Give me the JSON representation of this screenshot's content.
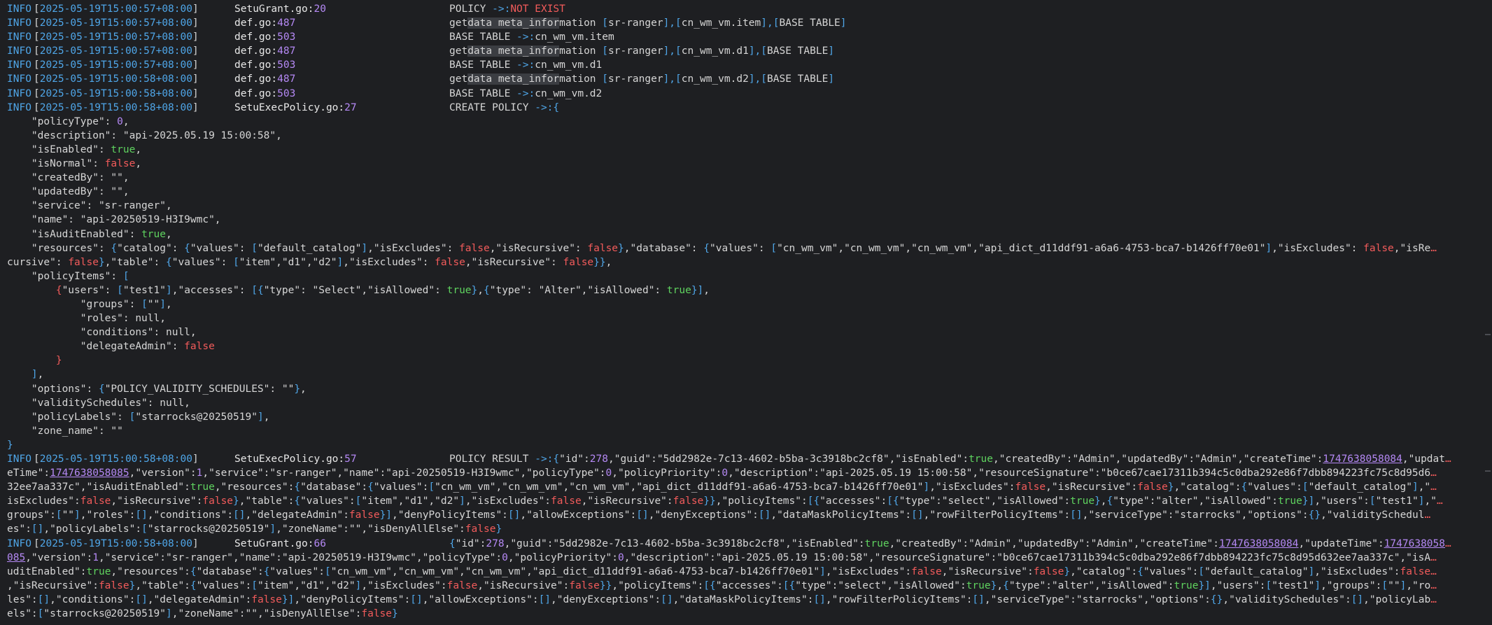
{
  "log": [
    {
      "level": "INFO",
      "ts": "2025-05-19T15:00:57+08:00",
      "file": "SetuGrant.go",
      "line": "20",
      "msg_html": "POLICY <span class=\"blue\">-&gt;:</span><span class=\"red\">NOT EXIST</span>"
    },
    {
      "level": "INFO",
      "ts": "2025-05-19T15:00:57+08:00",
      "file": "def.go",
      "line": "487",
      "msg_html": "get<span class=\"hl\">data meta_infor</span>mation <span class=\"blue\">[</span>sr-ranger<span class=\"blue\">],[</span>cn_wm_vm.item<span class=\"blue\">],[</span>BASE TABLE<span class=\"blue\">]</span>"
    },
    {
      "level": "INFO",
      "ts": "2025-05-19T15:00:57+08:00",
      "file": "def.go",
      "line": "503",
      "msg_html": "BASE TABLE <span class=\"blue\">-&gt;:</span>cn_wm_vm.item"
    },
    {
      "level": "INFO",
      "ts": "2025-05-19T15:00:57+08:00",
      "file": "def.go",
      "line": "487",
      "msg_html": "get<span class=\"hl\">data meta_infor</span>mation <span class=\"blue\">[</span>sr-ranger<span class=\"blue\">],[</span>cn_wm_vm.d1<span class=\"blue\">],[</span>BASE TABLE<span class=\"blue\">]</span>"
    },
    {
      "level": "INFO",
      "ts": "2025-05-19T15:00:57+08:00",
      "file": "def.go",
      "line": "503",
      "msg_html": "BASE TABLE <span class=\"blue\">-&gt;:</span>cn_wm_vm.d1"
    },
    {
      "level": "INFO",
      "ts": "2025-05-19T15:00:58+08:00",
      "file": "def.go",
      "line": "487",
      "msg_html": "get<span class=\"hl\">data meta_infor</span>mation <span class=\"blue\">[</span>sr-ranger<span class=\"blue\">],[</span>cn_wm_vm.d2<span class=\"blue\">],[</span>BASE TABLE<span class=\"blue\">]</span>"
    },
    {
      "level": "INFO",
      "ts": "2025-05-19T15:00:58+08:00",
      "file": "def.go",
      "line": "503",
      "msg_html": "BASE TABLE <span class=\"blue\">-&gt;:</span>cn_wm_vm.d2"
    },
    {
      "level": "INFO",
      "ts": "2025-05-19T15:00:58+08:00",
      "file": "SetuExecPolicy.go",
      "line": "27",
      "msg_html": "CREATE POLICY <span class=\"blue\">-&gt;:{</span>"
    },
    {
      "html": "    \"policyType\": <span class=\"purple\">0</span>,"
    },
    {
      "html": "    \"description\": \"api-2025.05.19 15:00:58\","
    },
    {
      "html": "    \"isEnabled\": <span class=\"green\">true</span>,"
    },
    {
      "html": "    \"isNormal\": <span class=\"red\">false</span>,"
    },
    {
      "html": "    \"createdBy\": \"\","
    },
    {
      "html": "    \"updatedBy\": \"\","
    },
    {
      "html": "    \"service\": \"sr-ranger\","
    },
    {
      "html": "    \"name\": \"api-20250519-H3I9wmc\","
    },
    {
      "html": "    \"isAuditEnabled\": <span class=\"green\">true</span>,"
    },
    {
      "html": "    \"resources\": <span class=\"blue\">{</span>\"catalog\": <span class=\"blue\">{</span>\"values\": <span class=\"blue\">[</span>\"default_catalog\"<span class=\"blue\">]</span>,\"isExcludes\": <span class=\"red\">false</span>,\"isRecursive\": <span class=\"red\">false</span><span class=\"blue\">}</span>,\"database\": <span class=\"blue\">{</span>\"values\": <span class=\"blue\">[</span>\"cn_wm_vm\",\"cn_wm_vm\",\"cn_wm_vm\",\"api_dict_d11ddf91-a6a6-4753-bca7-b1426ff70e01\"<span class=\"blue\">]</span>,\"isExcludes\": <span class=\"red\">false</span>,\"isRe<span class=\"cut\">…</span>"
    },
    {
      "html": "cursive\": <span class=\"red\">false</span><span class=\"blue\">}</span>,\"table\": <span class=\"blue\">{</span>\"values\": <span class=\"blue\">[</span>\"item\",\"d1\",\"d2\"<span class=\"blue\">]</span>,\"isExcludes\": <span class=\"red\">false</span>,\"isRecursive\": <span class=\"red\">false</span><span class=\"blue\">}}</span>,"
    },
    {
      "html": "    \"policyItems\": <span class=\"blue\">[</span>"
    },
    {
      "html": "        <span class=\"red\">{</span>\"users\": <span class=\"blue\">[</span>\"test1\"<span class=\"blue\">]</span>,\"accesses\": <span class=\"blue\">[{</span>\"type\": \"Select\",\"isAllowed\": <span class=\"green\">true</span><span class=\"blue\">}</span>,<span class=\"blue\">{</span>\"type\": \"Alter\",\"isAllowed\": <span class=\"green\">true</span><span class=\"blue\">}]</span>,"
    },
    {
      "html": "            \"groups\": <span class=\"blue\">[</span>\"\"<span class=\"blue\">]</span>,"
    },
    {
      "html": "            \"roles\": null,"
    },
    {
      "html": "            \"conditions\": null,"
    },
    {
      "html": "            \"delegateAdmin\": <span class=\"red\">false</span>"
    },
    {
      "html": "        <span class=\"red\">}</span>"
    },
    {
      "html": "    <span class=\"blue\">]</span>,"
    },
    {
      "html": "    \"options\": <span class=\"blue\">{</span>\"POLICY_VALIDITY_SCHEDULES\": \"\"<span class=\"blue\">}</span>,"
    },
    {
      "html": "    \"validitySchedules\": null,"
    },
    {
      "html": "    \"policyLabels\": <span class=\"blue\">[</span>\"starrocks@20250519\"<span class=\"blue\">]</span>,"
    },
    {
      "html": "    \"zone_name\": \"\""
    },
    {
      "html": "<span class=\"blue\">}</span>"
    },
    {
      "level": "INFO",
      "ts": "2025-05-19T15:00:58+08:00",
      "file": "SetuExecPolicy.go",
      "line": "57",
      "msg_html": "POLICY RESULT <span class=\"blue\">-&gt;:{</span>\"id\":<span class=\"purple\">278</span>,\"guid\":\"5dd2982e-7c13-4602-b5ba-3c3918bc2cf8\",\"isEnabled\":<span class=\"green\">true</span>,\"createdBy\":\"Admin\",\"updatedBy\":\"Admin\",\"createTime\":<span class=\"link\">1747638058084</span>,\"updat<span class=\"cut\">…</span>"
    },
    {
      "html": "eTime\":<span class=\"link\">1747638058085</span>,\"version\":<span class=\"purple\">1</span>,\"service\":\"sr-ranger\",\"name\":\"api-20250519-H3I9wmc\",\"policyType\":<span class=\"purple\">0</span>,\"policyPriority\":<span class=\"purple\">0</span>,\"description\":\"api-2025.05.19 15:00:58\",\"resourceSignature\":\"b0ce67cae17311b394c5c0dba292e86f7dbb894223fc75c8d95d6<span class=\"cut\">…</span>"
    },
    {
      "html": "32ee7aa337c\",\"isAuditEnabled\":<span class=\"green\">true</span>,\"resources\":<span class=\"blue\">{</span>\"database\":<span class=\"blue\">{</span>\"values\":<span class=\"blue\">[</span>\"cn_wm_vm\",\"cn_wm_vm\",\"cn_wm_vm\",\"api_dict_d11ddf91-a6a6-4753-bca7-b1426ff70e01\"<span class=\"blue\">]</span>,\"isExcludes\":<span class=\"red\">false</span>,\"isRecursive\":<span class=\"red\">false</span><span class=\"blue\">}</span>,\"catalog\":<span class=\"blue\">{</span>\"values\":<span class=\"blue\">[</span>\"default_catalog\"<span class=\"blue\">]</span>,\"<span class=\"cut\">…</span>"
    },
    {
      "html": "isExcludes\":<span class=\"red\">false</span>,\"isRecursive\":<span class=\"red\">false</span><span class=\"blue\">}</span>,\"table\":<span class=\"blue\">{</span>\"values\":<span class=\"blue\">[</span>\"item\",\"d1\",\"d2\"<span class=\"blue\">]</span>,\"isExcludes\":<span class=\"red\">false</span>,\"isRecursive\":<span class=\"red\">false</span><span class=\"blue\">}}</span>,\"policyItems\":<span class=\"blue\">[{</span>\"accesses\":<span class=\"blue\">[{</span>\"type\":\"select\",\"isAllowed\":<span class=\"green\">true</span><span class=\"blue\">}</span>,<span class=\"blue\">{</span>\"type\":\"alter\",\"isAllowed\":<span class=\"green\">true</span><span class=\"blue\">}]</span>,\"users\":<span class=\"blue\">[</span>\"test1\"<span class=\"blue\">]</span>,\"<span class=\"cut\">…</span>"
    },
    {
      "html": "groups\":<span class=\"blue\">[</span>\"\"<span class=\"blue\">]</span>,\"roles\":<span class=\"blue\">[]</span>,\"conditions\":<span class=\"blue\">[]</span>,\"delegateAdmin\":<span class=\"red\">false</span><span class=\"blue\">}]</span>,\"denyPolicyItems\":<span class=\"blue\">[]</span>,\"allowExceptions\":<span class=\"blue\">[]</span>,\"denyExceptions\":<span class=\"blue\">[]</span>,\"dataMaskPolicyItems\":<span class=\"blue\">[]</span>,\"rowFilterPolicyItems\":<span class=\"blue\">[]</span>,\"serviceType\":\"starrocks\",\"options\":<span class=\"blue\">{}</span>,\"validitySchedul<span class=\"cut\">…</span>"
    },
    {
      "html": "es\":<span class=\"blue\">[]</span>,\"policyLabels\":<span class=\"blue\">[</span>\"starrocks@20250519\"<span class=\"blue\">]</span>,\"zoneName\":\"\",\"isDenyAllElse\":<span class=\"red\">false</span><span class=\"blue\">}</span>"
    },
    {
      "level": "INFO",
      "ts": "2025-05-19T15:00:58+08:00",
      "file": "SetuGrant.go",
      "line": "66",
      "msg_html": "<span class=\"blue\">{</span>\"id\":<span class=\"purple\">278</span>,\"guid\":\"5dd2982e-7c13-4602-b5ba-3c3918bc2cf8\",\"isEnabled\":<span class=\"green\">true</span>,\"createdBy\":\"Admin\",\"updatedBy\":\"Admin\",\"createTime\":<span class=\"link\">1747638058084</span>,\"updateTime\":<span class=\"link\">1747638058</span><span class=\"cut\">…</span>"
    },
    {
      "html": "<span class=\"link\">085</span>,\"version\":<span class=\"purple\">1</span>,\"service\":\"sr-ranger\",\"name\":\"api-20250519-H3I9wmc\",\"policyType\":<span class=\"purple\">0</span>,\"policyPriority\":<span class=\"purple\">0</span>,\"description\":\"api-2025.05.19 15:00:58\",\"resourceSignature\":\"b0ce67cae17311b394c5c0dba292e86f7dbb894223fc75c8d95d632ee7aa337c\",\"isA<span class=\"cut\">…</span>"
    },
    {
      "html": "uditEnabled\":<span class=\"green\">true</span>,\"resources\":<span class=\"blue\">{</span>\"database\":<span class=\"blue\">{</span>\"values\":<span class=\"blue\">[</span>\"cn_wm_vm\",\"cn_wm_vm\",\"cn_wm_vm\",\"api_dict_d11ddf91-a6a6-4753-bca7-b1426ff70e01\"<span class=\"blue\">]</span>,\"isExcludes\":<span class=\"red\">false</span>,\"isRecursive\":<span class=\"red\">false</span><span class=\"blue\">}</span>,\"catalog\":<span class=\"blue\">{</span>\"values\":<span class=\"blue\">[</span>\"default_catalog\"<span class=\"blue\">]</span>,\"isExcludes\":<span class=\"red\">false</span><span class=\"cut\">…</span>"
    },
    {
      "html": ",\"isRecursive\":<span class=\"red\">false</span><span class=\"blue\">}</span>,\"table\":<span class=\"blue\">{</span>\"values\":<span class=\"blue\">[</span>\"item\",\"d1\",\"d2\"<span class=\"blue\">]</span>,\"isExcludes\":<span class=\"red\">false</span>,\"isRecursive\":<span class=\"red\">false</span><span class=\"blue\">}}</span>,\"policyItems\":<span class=\"blue\">[{</span>\"accesses\":<span class=\"blue\">[{</span>\"type\":\"select\",\"isAllowed\":<span class=\"green\">true</span><span class=\"blue\">}</span>,<span class=\"blue\">{</span>\"type\":\"alter\",\"isAllowed\":<span class=\"green\">true</span><span class=\"blue\">}]</span>,\"users\":<span class=\"blue\">[</span>\"test1\"<span class=\"blue\">]</span>,\"groups\":<span class=\"blue\">[</span>\"\"<span class=\"blue\">]</span>,\"ro<span class=\"cut\">…</span>"
    },
    {
      "html": "les\":<span class=\"blue\">[]</span>,\"conditions\":<span class=\"blue\">[]</span>,\"delegateAdmin\":<span class=\"red\">false</span><span class=\"blue\">}]</span>,\"denyPolicyItems\":<span class=\"blue\">[]</span>,\"allowExceptions\":<span class=\"blue\">[]</span>,\"denyExceptions\":<span class=\"blue\">[]</span>,\"dataMaskPolicyItems\":<span class=\"blue\">[]</span>,\"rowFilterPolicyItems\":<span class=\"blue\">[]</span>,\"serviceType\":\"starrocks\",\"options\":<span class=\"blue\">{}</span>,\"validitySchedules\":<span class=\"blue\">[]</span>,\"policyLab<span class=\"cut\">…</span>"
    },
    {
      "html": "els\":<span class=\"blue\">[</span>\"starrocks@20250519\"<span class=\"blue\">]</span>,\"zoneName\":\"\",\"isDenyAllElse\":<span class=\"red\">false</span><span class=\"blue\">}</span>"
    }
  ]
}
